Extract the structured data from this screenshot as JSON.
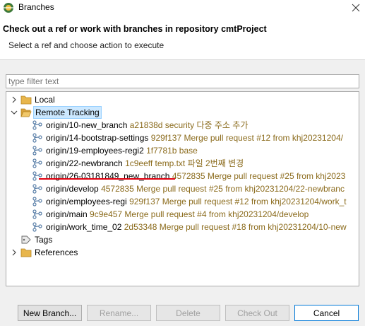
{
  "window": {
    "title": "Branches"
  },
  "header": {
    "title": "Check out a ref or work with branches in repository cmtProject",
    "message": "Select a ref and choose action to execute"
  },
  "filter": {
    "placeholder": "type filter text",
    "value": ""
  },
  "tree": {
    "local": {
      "label": "Local",
      "expanded": false
    },
    "remote": {
      "label": "Remote Tracking",
      "expanded": true,
      "branches": [
        {
          "name": "origin/10-new_branch",
          "commit": "a21838d security 다중 주소 추가"
        },
        {
          "name": "origin/14-bootstrap-settings",
          "commit": "929f137 Merge pull request #12 from khj20231204/"
        },
        {
          "name": "origin/19-employees-regi2",
          "commit": "1f7781b base"
        },
        {
          "name": "origin/22-newbranch",
          "commit": "1c9eeff temp.txt 파일 2번째 변경"
        },
        {
          "name": "origin/26-03181849_new_branch",
          "commit": "4572835 Merge pull request #25 from khj2023"
        },
        {
          "name": "origin/develop",
          "commit": "4572835 Merge pull request #25 from khj20231204/22-newbranc"
        },
        {
          "name": "origin/employees-regi",
          "commit": "929f137 Merge pull request #12 from khj20231204/work_t"
        },
        {
          "name": "origin/main",
          "commit": "9c9e457 Merge pull request #4 from khj20231204/develop"
        },
        {
          "name": "origin/work_time_02",
          "commit": "2d53348 Merge pull request #18 from khj20231204/10-new"
        }
      ]
    },
    "tags": {
      "label": "Tags"
    },
    "references": {
      "label": "References",
      "expanded": false
    }
  },
  "buttons": {
    "new_branch": "New Branch...",
    "rename": "Rename...",
    "delete": "Delete",
    "checkout": "Check Out",
    "cancel": "Cancel"
  },
  "colors": {
    "commit_text": "#8b6b1c",
    "annotation_underline": "#e0000f",
    "folder": "#e8b64c"
  }
}
